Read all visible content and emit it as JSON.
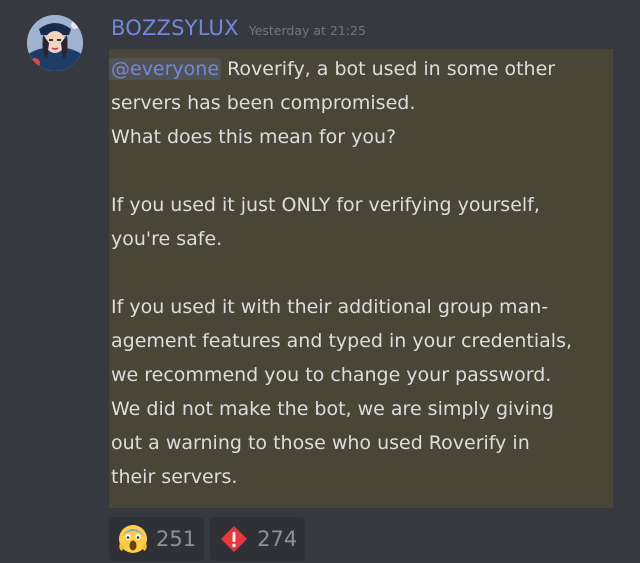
{
  "message": {
    "author": "BOZZSYLUX",
    "timestamp": "Yesterday at 21:25",
    "mention": "@everyone",
    "lines": [
      " Roverify, a bot used in some other",
      "servers has been compromised.",
      "What does this mean for you?",
      "",
      "If you used it just ONLY for verifying yourself,",
      "you're safe.",
      "",
      "If you used it with their additional group man-",
      "agement features and typed in your credentials,",
      "we recommend you to change your password.",
      "We did not make the bot, we are simply giving",
      "out a warning to those who used Roverify in",
      "their servers."
    ],
    "highlight_color": "#4a4637"
  },
  "reactions": [
    {
      "icon": "scream-emoji-icon",
      "count": "251"
    },
    {
      "icon": "exclamation-diamond-icon",
      "count": "274"
    }
  ],
  "colors": {
    "background": "#36393f",
    "username": "#7289da",
    "text": "#dcddde",
    "timestamp": "#72767d"
  }
}
